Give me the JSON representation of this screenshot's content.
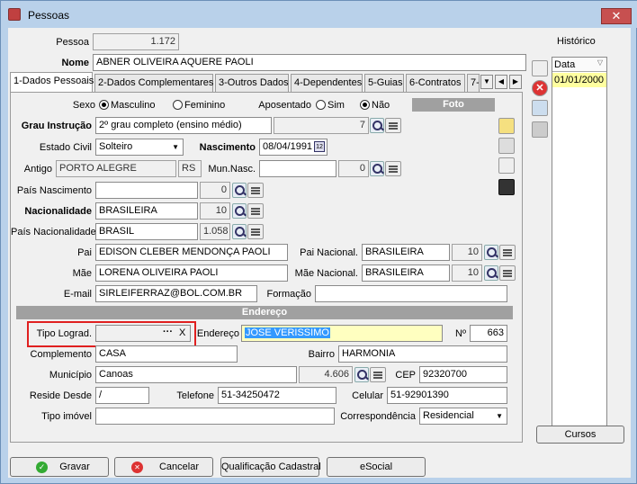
{
  "window": {
    "title": "Pessoas",
    "close": "✕"
  },
  "pessoa": {
    "label": "Pessoa",
    "value": "1.172"
  },
  "nome": {
    "label": "Nome",
    "value": "ABNER OLIVEIRA AQUERE PAOLI"
  },
  "tabs": [
    {
      "label": "1-Dados Pessoais"
    },
    {
      "label": "2-Dados Complementares"
    },
    {
      "label": "3-Outros Dados"
    },
    {
      "label": "4-Dependentes"
    },
    {
      "label": "5-Guias"
    },
    {
      "label": "6-Contratos"
    },
    {
      "label": "7-"
    }
  ],
  "sexo": {
    "label": "Sexo",
    "opt1": "Masculino",
    "opt2": "Feminino",
    "selected": "Masculino"
  },
  "aposentado": {
    "label": "Aposentado",
    "opt1": "Sim",
    "opt2": "Não",
    "selected": "Não"
  },
  "foto": {
    "label": "Foto"
  },
  "grau": {
    "label": "Grau Instrução",
    "value": "2º grau completo (ensino médio)",
    "code": "7"
  },
  "estado_civil": {
    "label": "Estado Civil",
    "value": "Solteiro"
  },
  "nascimento": {
    "label": "Nascimento",
    "value": "08/04/1991",
    "cal": "12"
  },
  "antigo": {
    "label": "Antigo",
    "value": "PORTO ALEGRE",
    "uf": "RS"
  },
  "mun_nasc": {
    "label": "Mun.Nasc.",
    "value": "",
    "code": "0"
  },
  "pais_nasc": {
    "label": "País Nascimento",
    "value": "",
    "code": "0"
  },
  "nacionalidade": {
    "label": "Nacionalidade",
    "value": "BRASILEIRA",
    "code": "10"
  },
  "pais_nac": {
    "label": "País Nacionalidade",
    "value": "BRASIL",
    "code": "1.058"
  },
  "pai": {
    "label": "Pai",
    "value": "EDISON CLEBER MENDONÇA PAOLI",
    "nac_label": "Pai Nacional.",
    "nac": "BRASILEIRA",
    "code": "10"
  },
  "mae": {
    "label": "Mãe",
    "value": "LORENA OLIVEIRA PAOLI",
    "nac_label": "Mãe Nacional.",
    "nac": "BRASILEIRA",
    "code": "10"
  },
  "email": {
    "label": "E-mail",
    "value": "SIRLEIFERRAZ@BOL.COM.BR"
  },
  "formacao": {
    "label": "Formação",
    "value": ""
  },
  "endereco_section": "Endereço",
  "tipo_lograd": {
    "label": "Tipo Lograd.",
    "dots": "···",
    "clear": "X"
  },
  "endereco": {
    "label": "Endereço",
    "value": "JOSE VERISSIMO"
  },
  "numero": {
    "label": "Nº",
    "value": "663"
  },
  "complemento": {
    "label": "Complemento",
    "value": "CASA"
  },
  "bairro": {
    "label": "Bairro",
    "value": "HARMONIA"
  },
  "municipio": {
    "label": "Município",
    "value": "Canoas",
    "code": "4.606"
  },
  "cep": {
    "label": "CEP",
    "value": "92320700"
  },
  "reside_desde": {
    "label": "Reside Desde",
    "value": "/"
  },
  "telefone": {
    "label": "Telefone",
    "value": "51-34250472"
  },
  "celular": {
    "label": "Celular",
    "value": "51-92901390"
  },
  "tipo_imovel": {
    "label": "Tipo imóvel",
    "value": ""
  },
  "correspondencia": {
    "label": "Correspondência",
    "value": "Residencial"
  },
  "historico": {
    "label": "Histórico",
    "col": "Data",
    "rows": [
      "01/01/2000"
    ]
  },
  "buttons": {
    "gravar": "Gravar",
    "cancelar": "Cancelar",
    "qualificacao": "Qualificação Cadastral",
    "esocial": "eSocial",
    "cursos": "Cursos"
  }
}
